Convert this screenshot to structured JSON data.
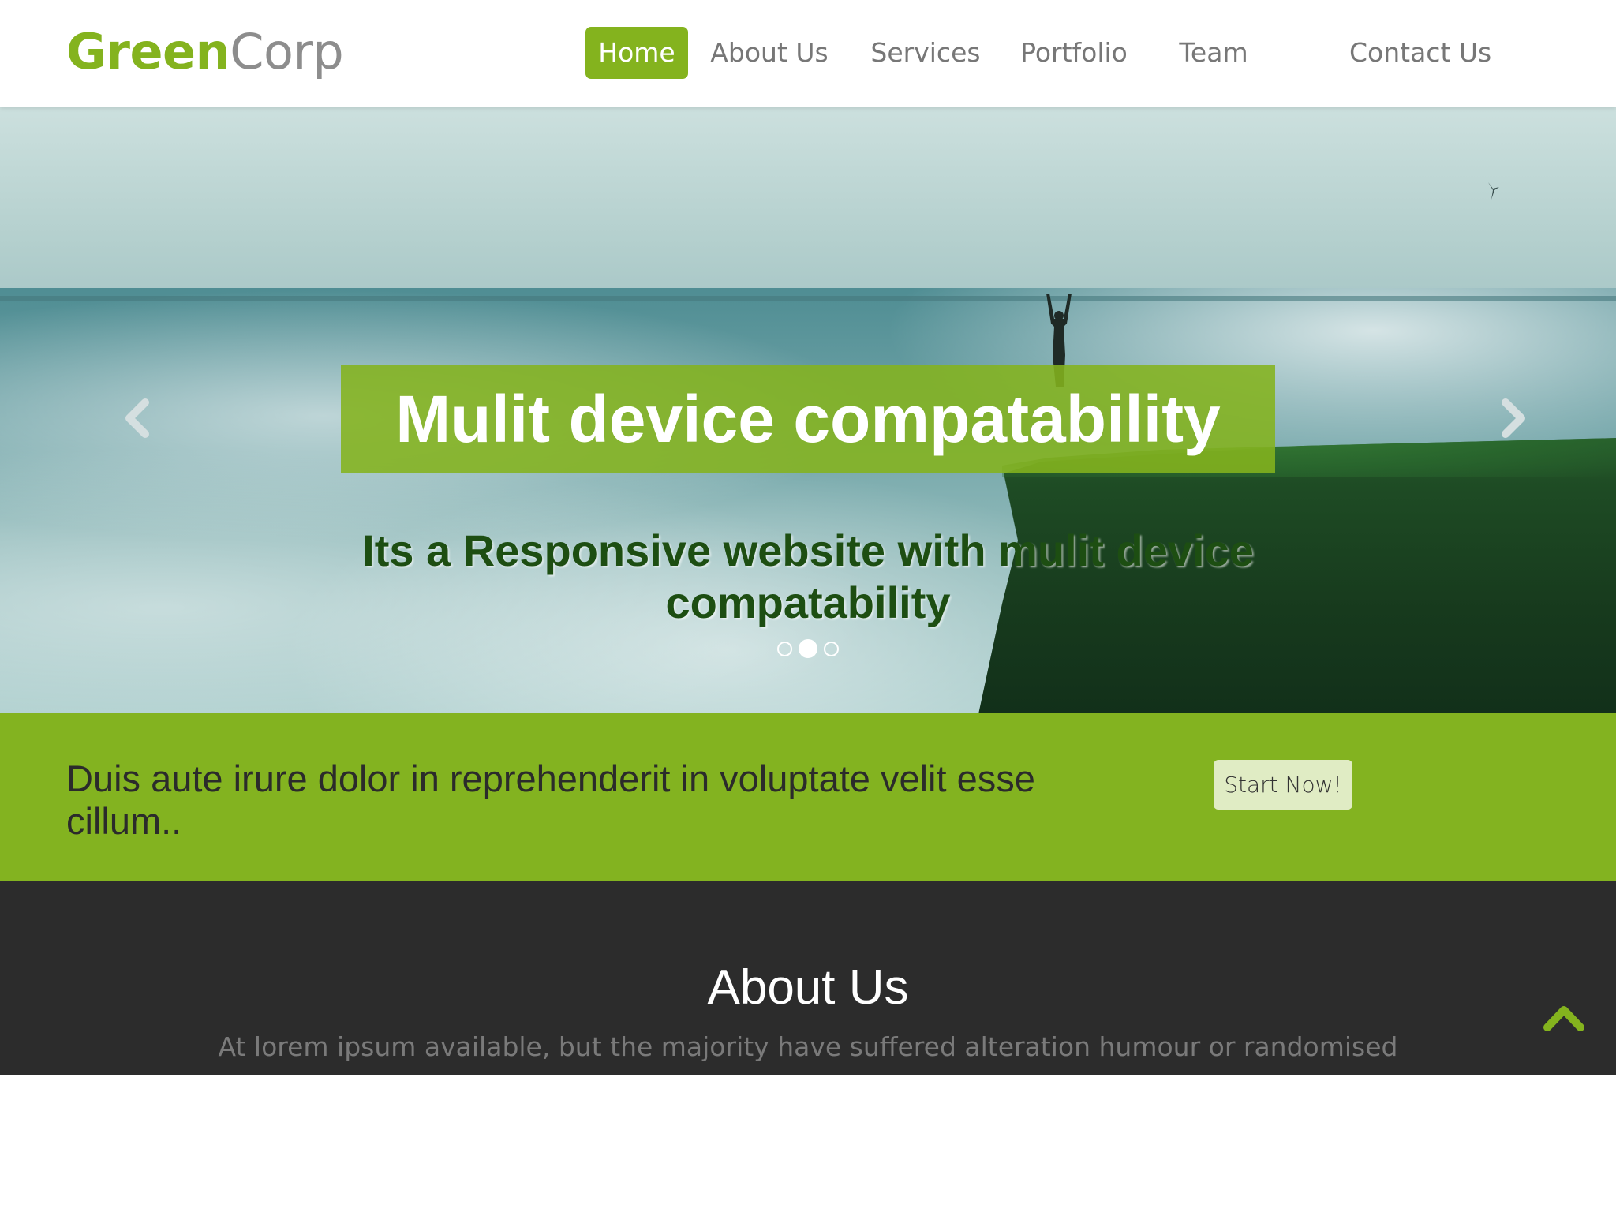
{
  "brand": {
    "part1": "Green",
    "part2": "Corp"
  },
  "nav": {
    "items": [
      {
        "label": "Home",
        "active": true
      },
      {
        "label": "About Us"
      },
      {
        "label": "Services"
      },
      {
        "label": "Portfolio"
      },
      {
        "label": "Team"
      },
      {
        "label": "Contact Us"
      }
    ]
  },
  "hero": {
    "title": "Mulit device compatability",
    "subtitle": "Its a Responsive website with mulit device compatability",
    "slides_total": 3,
    "active_slide": 2,
    "prev_icon": "chevron-left-icon",
    "next_icon": "chevron-right-icon"
  },
  "cta": {
    "text": "Duis aute irure dolor in reprehenderit in voluptate velit esse cillum..",
    "button_label": "Start Now!"
  },
  "about": {
    "title": "About Us",
    "subtitle": "At lorem ipsum available, but the majority have suffered alteration humour or randomised"
  },
  "colors": {
    "accent": "#84b31e",
    "dark_section": "#2c2c2c",
    "cta_button_bg": "#e0ecc4"
  },
  "scroll_top_icon": "chevron-up-icon"
}
